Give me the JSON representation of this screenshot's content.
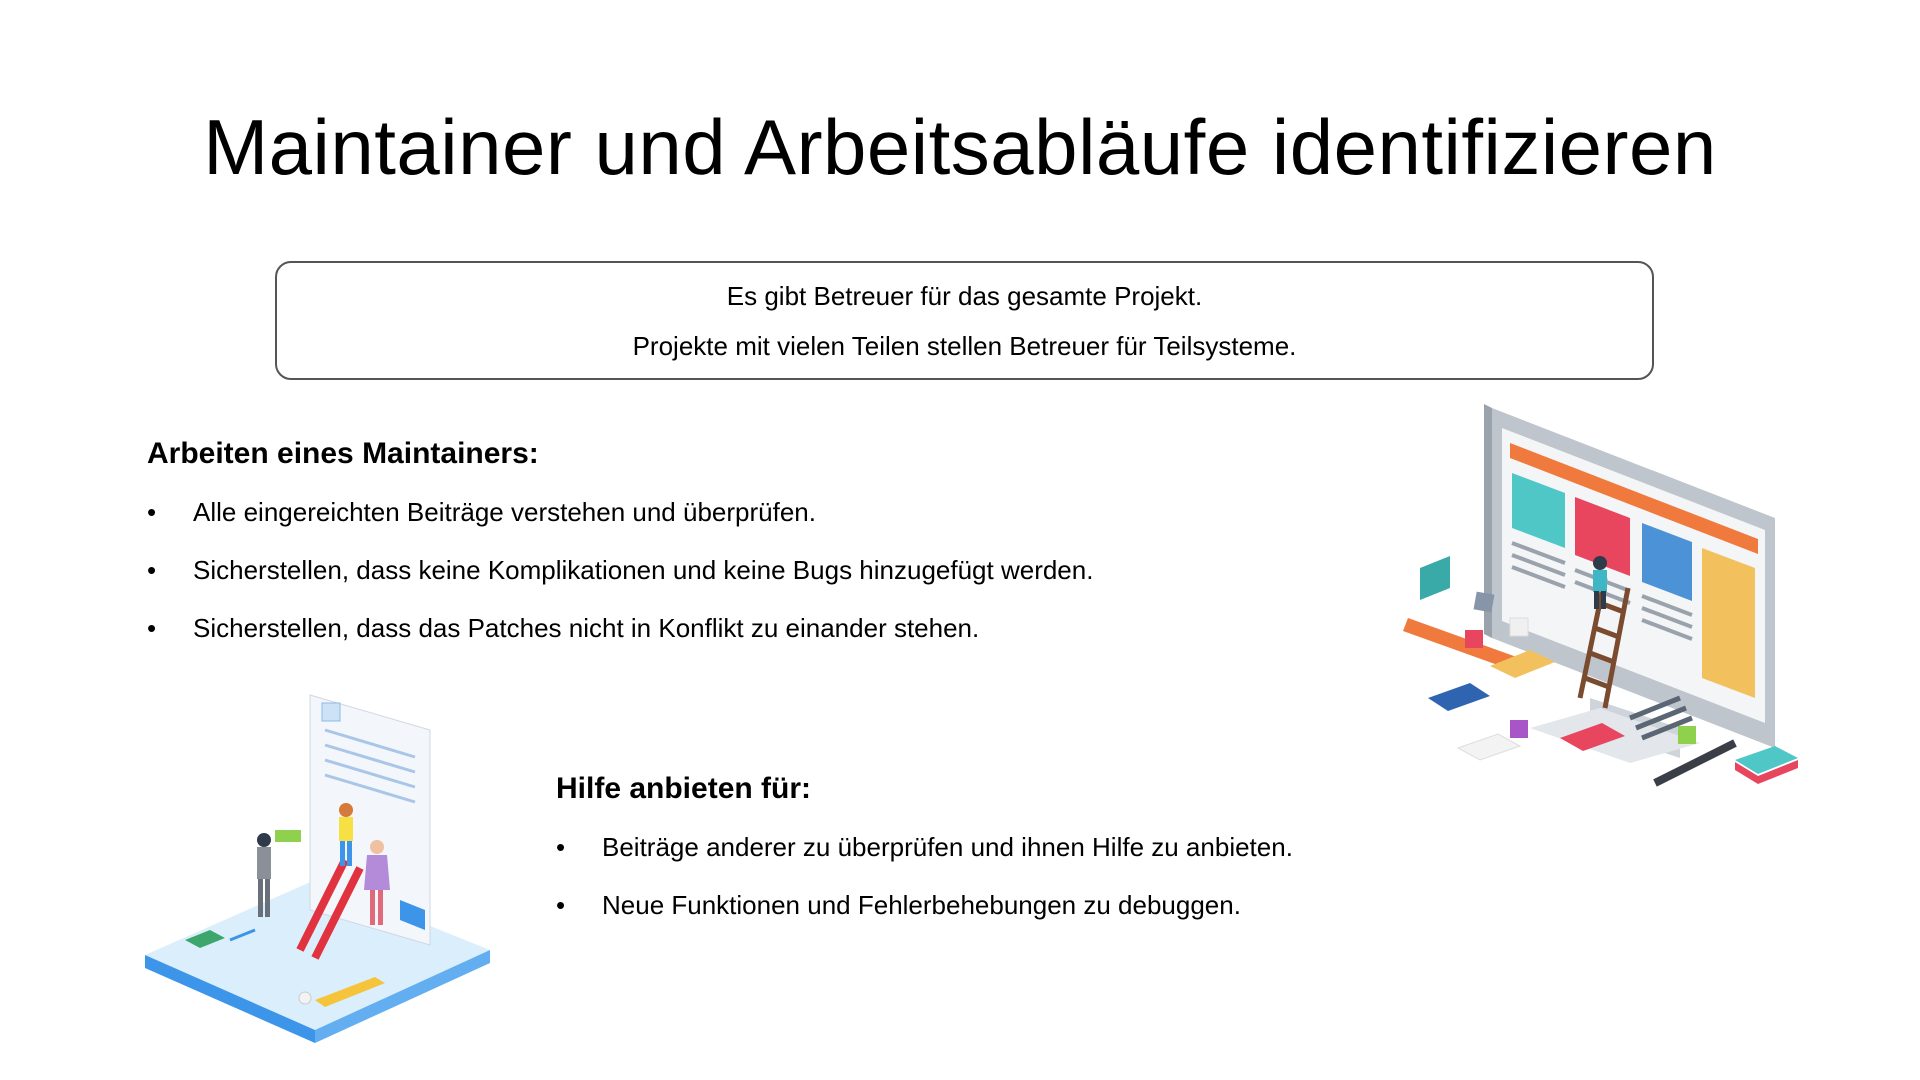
{
  "slide": {
    "title": "Maintainer und Arbeitsabläufe identifizieren",
    "callout": {
      "line1": "Es gibt Betreuer für das gesamte Projekt.",
      "line2": "Projekte mit vielen Teilen stellen Betreuer für Teilsysteme."
    },
    "maintainer_section": {
      "heading": "Arbeiten eines Maintainers:",
      "bullet_char": "•",
      "items": [
        "Alle eingereichten Beiträge verstehen und überprüfen.",
        "Sicherstellen, dass keine Komplikationen und keine Bugs hinzugefügt werden.",
        "Sicherstellen, dass das Patches nicht in Konflikt zu einander stehen."
      ]
    },
    "help_section": {
      "heading": "Hilfe anbieten für:",
      "bullet_char": "•",
      "items": [
        "Beiträge anderer zu überprüfen und ihnen Hilfe zu anbieten.",
        "Neue Funktionen und Fehlerbehebungen zu debuggen."
      ]
    },
    "illustrations": {
      "monitor": "isometric-monitor-illustration",
      "document": "isometric-document-team-illustration"
    },
    "colors": {
      "callout_border": "#555555",
      "accent_orange": "#F07A3E",
      "accent_teal": "#4FC7C7",
      "accent_pink": "#E8455F",
      "accent_blue": "#4B93D6",
      "accent_yellow": "#F2C15E"
    }
  }
}
